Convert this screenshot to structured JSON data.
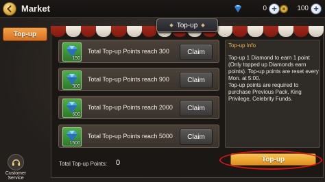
{
  "header": {
    "title": "Market",
    "currencies": [
      {
        "name": "diamond",
        "amount": "0",
        "icon": "diamond-icon"
      },
      {
        "name": "coin",
        "amount": "100",
        "icon": "coin-icon"
      }
    ]
  },
  "sidebar": {
    "active_tab": "Top-up",
    "customer_service_label": "Customer Service"
  },
  "panel": {
    "header": "Top-up",
    "rewards": [
      {
        "qty": "150",
        "text": "Total Top-up Points reach 300",
        "button": "Claim"
      },
      {
        "qty": "300",
        "text": "Total Top-up Points reach 900",
        "button": "Claim"
      },
      {
        "qty": "600",
        "text": "Total Top-up Points reach 2000",
        "button": "Claim"
      },
      {
        "qty": "1500",
        "text": "Total Top-up Points reach 5000",
        "button": "Claim"
      }
    ],
    "total_label": "Total Top-up Points:",
    "total_value": "0",
    "info_title": "Top-up Info",
    "info_text": "Top-up 1 Diamond to earn 1 point (Only topped up Diamonds earn points). Top-up points are reset every Mon. at 5:00.\nTop-up points are required to purchase Previous Pack, King Privilege, Celebrity Funds.",
    "topup_button": "Top-up"
  },
  "colors": {
    "accent_orange": "#e18d1a",
    "highlight_red": "#e01313",
    "info_title": "#f2b34a"
  }
}
